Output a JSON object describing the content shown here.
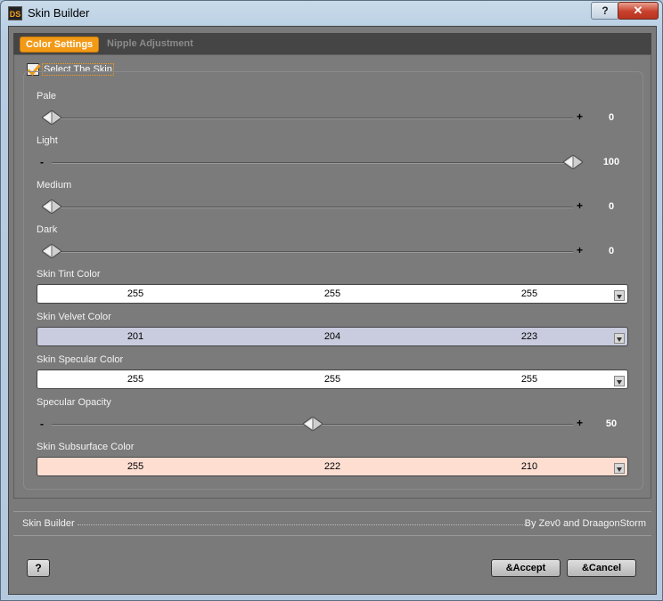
{
  "window": {
    "app_icon": "DS",
    "title": "Skin Builder",
    "help_glyph": "?",
    "close_glyph": "✕"
  },
  "tabs": [
    {
      "label": "Color Settings",
      "active": true
    },
    {
      "label": "Nipple Adjustment",
      "active": false
    }
  ],
  "select_skin": {
    "label": "Select The Skin",
    "checked": true
  },
  "sliders": [
    {
      "label": "Pale",
      "value": "0",
      "fraction": 0.0,
      "minus": "",
      "plus": "+"
    },
    {
      "label": "Light",
      "value": "100",
      "fraction": 1.0,
      "minus": "-",
      "plus": ""
    },
    {
      "label": "Medium",
      "value": "0",
      "fraction": 0.0,
      "minus": "",
      "plus": "+"
    },
    {
      "label": "Dark",
      "value": "0",
      "fraction": 0.0,
      "minus": "",
      "plus": "+"
    }
  ],
  "colors": [
    {
      "label": "Skin Tint Color",
      "r": "255",
      "g": "255",
      "b": "255",
      "bg": "#ffffff"
    },
    {
      "label": "Skin Velvet Color",
      "r": "201",
      "g": "204",
      "b": "223",
      "bg": "#c9ccdf"
    },
    {
      "label": "Skin Specular Color",
      "r": "255",
      "g": "255",
      "b": "255",
      "bg": "#ffffff"
    }
  ],
  "specular_opacity": {
    "label": "Specular Opacity",
    "value": "50",
    "fraction": 0.5,
    "minus": "-",
    "plus": "+"
  },
  "subsurface": {
    "label": "Skin Subsurface Color",
    "r": "255",
    "g": "222",
    "b": "210",
    "bg": "#ffded2"
  },
  "footer": {
    "left": "Skin Builder",
    "right": "By Zev0 and DraagonStorm"
  },
  "buttons": {
    "help": "?",
    "accept": "&Accept",
    "cancel": "&Cancel"
  },
  "accent_color": "#f29a17"
}
